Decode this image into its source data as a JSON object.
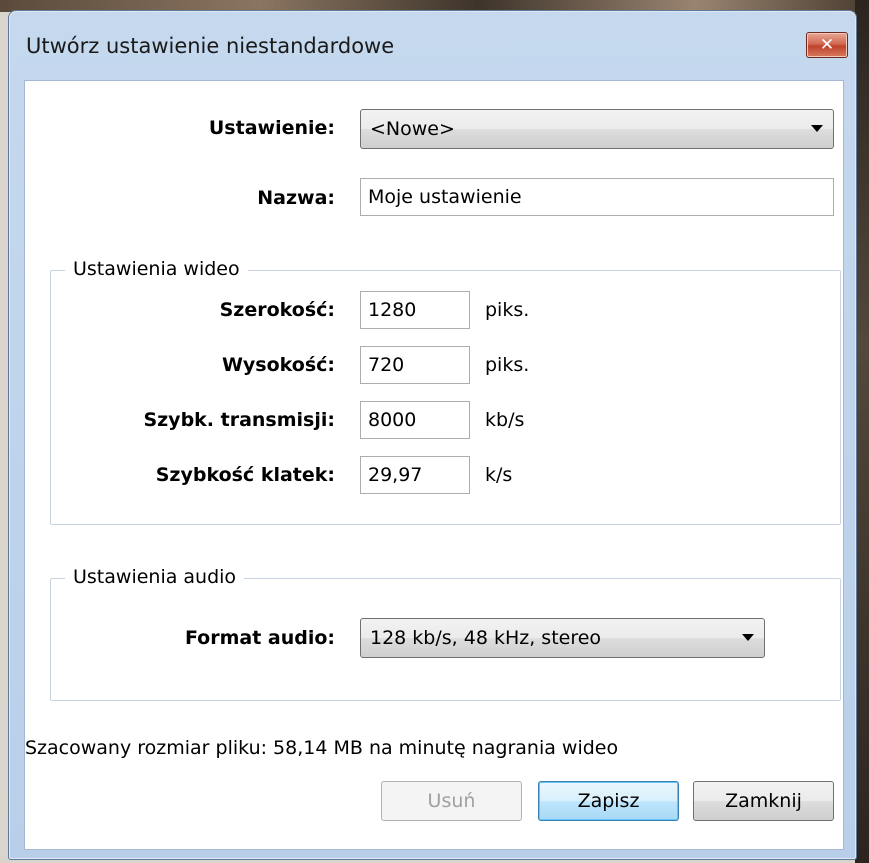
{
  "window": {
    "title": "Utwórz ustawienie niestandardowe",
    "close_glyph": "✕"
  },
  "preset": {
    "label": "Ustawienie:",
    "value": "<Nowe>"
  },
  "name": {
    "label": "Nazwa:",
    "value": "Moje ustawienie"
  },
  "video": {
    "group_title": "Ustawienia wideo",
    "width": {
      "label": "Szerokość:",
      "value": "1280",
      "unit": "piks."
    },
    "height": {
      "label": "Wysokość:",
      "value": "720",
      "unit": "piks."
    },
    "bitrate": {
      "label": "Szybk. transmisji:",
      "value": "8000",
      "unit": "kb/s"
    },
    "framerate": {
      "label": "Szybkość klatek:",
      "value": "29,97",
      "unit": "k/s"
    }
  },
  "audio": {
    "group_title": "Ustawienia audio",
    "format": {
      "label": "Format audio:",
      "value": "128 kb/s, 48 kHz, stereo"
    }
  },
  "estimate_text": "Szacowany rozmiar pliku: 58,14 MB na minutę nagrania wideo",
  "buttons": {
    "delete": "Usuń",
    "save": "Zapisz",
    "close": "Zamknij"
  },
  "colors": {
    "title_bar": "#c5d8ee",
    "close_button": "#c0422b",
    "default_button_border": "#3c7fb1",
    "groupbox_border": "#c8d3e2"
  },
  "icons": {
    "close": "close-icon",
    "dropdown": "chevron-down-icon"
  }
}
